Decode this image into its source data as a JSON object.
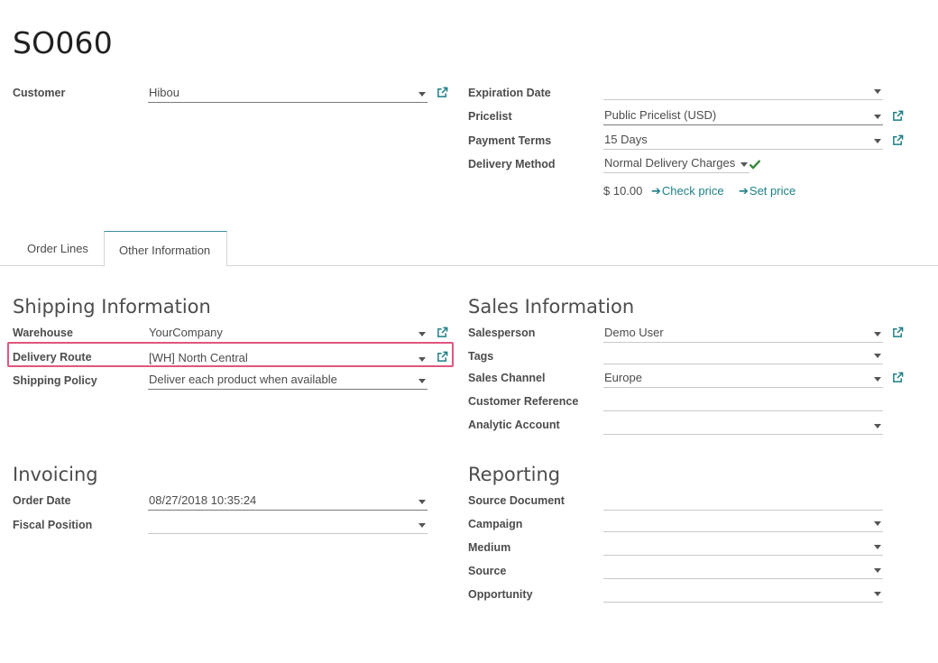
{
  "record_title": "SO060",
  "header": {
    "customer_label": "Customer",
    "customer_value": "Hibou",
    "expiration_label": "Expiration Date",
    "expiration_value": "",
    "pricelist_label": "Pricelist",
    "pricelist_value": "Public Pricelist (USD)",
    "payment_terms_label": "Payment Terms",
    "payment_terms_value": "15 Days",
    "delivery_method_label": "Delivery Method",
    "delivery_method_value": "Normal Delivery Charges",
    "delivery_price": "$ 10.00",
    "check_price_label": "Check price",
    "set_price_label": "Set price"
  },
  "tabs": [
    {
      "label": "Order Lines",
      "active": false
    },
    {
      "label": "Other Information",
      "active": true
    }
  ],
  "shipping": {
    "heading": "Shipping Information",
    "warehouse_label": "Warehouse",
    "warehouse_value": "YourCompany",
    "route_label": "Delivery Route",
    "route_value": "[WH] North Central",
    "policy_label": "Shipping Policy",
    "policy_value": "Deliver each product when available"
  },
  "sales": {
    "heading": "Sales Information",
    "salesperson_label": "Salesperson",
    "salesperson_value": "Demo User",
    "tags_label": "Tags",
    "tags_value": "",
    "channel_label": "Sales Channel",
    "channel_value": "Europe",
    "customer_ref_label": "Customer Reference",
    "customer_ref_value": "",
    "analytic_label": "Analytic Account",
    "analytic_value": ""
  },
  "invoicing": {
    "heading": "Invoicing",
    "order_date_label": "Order Date",
    "order_date_value": "08/27/2018 10:35:24",
    "fiscal_label": "Fiscal Position",
    "fiscal_value": ""
  },
  "reporting": {
    "heading": "Reporting",
    "source_doc_label": "Source Document",
    "campaign_label": "Campaign",
    "medium_label": "Medium",
    "source_label": "Source",
    "opportunity_label": "Opportunity"
  },
  "colors": {
    "accent": "#1d7f86",
    "highlight": "#e0567f",
    "check": "#3c8a3c"
  }
}
